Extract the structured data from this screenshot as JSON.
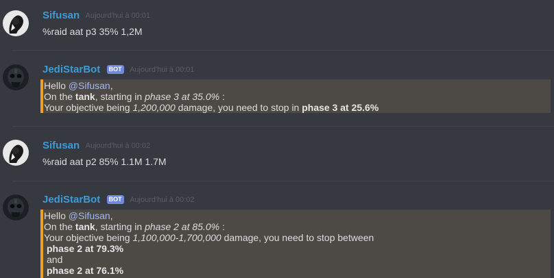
{
  "messages": [
    {
      "author": "Sifusan",
      "timestamp": "Aujourd'hui à 00:01",
      "text": "%raid aat p3 35% 1,2M"
    },
    {
      "author": "JediStarBot",
      "bot_tag": "BOT",
      "timestamp": "Aujourd'hui à 00:01",
      "embed": {
        "line1_prefix": "Hello ",
        "line1_mention": "@Sifusan",
        "line1_suffix": ",",
        "line2_a": "On the ",
        "line2_b": "tank",
        "line2_c": ", starting in ",
        "line2_d": "phase 3 at 35.0%",
        "line2_e": " :",
        "line3_a": "Your objective being ",
        "line3_b": "1,200,000",
        "line3_c": " damage, you need to stop in ",
        "line3_d": "phase 3 at 25.6%"
      }
    },
    {
      "author": "Sifusan",
      "timestamp": "Aujourd'hui à 00:02",
      "text": "%raid aat p2 85% 1.1M 1.7M"
    },
    {
      "author": "JediStarBot",
      "bot_tag": "BOT",
      "timestamp": "Aujourd'hui à 00:02",
      "embed": {
        "line1_prefix": "Hello ",
        "line1_mention": "@Sifusan",
        "line1_suffix": ",",
        "line2_a": "On the ",
        "line2_b": "tank",
        "line2_c": ", starting in ",
        "line2_d": "phase 2 at 85.0%",
        "line2_e": " :",
        "line3_a": "Your objective being  ",
        "line3_b": "1,100,000-1,700,000",
        "line3_c": " damage, you need to stop between",
        "line4": "phase 2 at 79.3%",
        "line5": "and",
        "line6": "phase 2 at 76.1%"
      }
    }
  ],
  "colors": {
    "background": "#36393f",
    "username": "#3d9bd6",
    "embed_bar": "#f0a02a",
    "embed_bg": "#4d4944",
    "bot_tag": "#7289da",
    "mention": "#a3b7f2"
  },
  "icons": {
    "user_avatar": "sifusan-avatar-icon",
    "bot_avatar": "jedistarbot-avatar-icon"
  }
}
